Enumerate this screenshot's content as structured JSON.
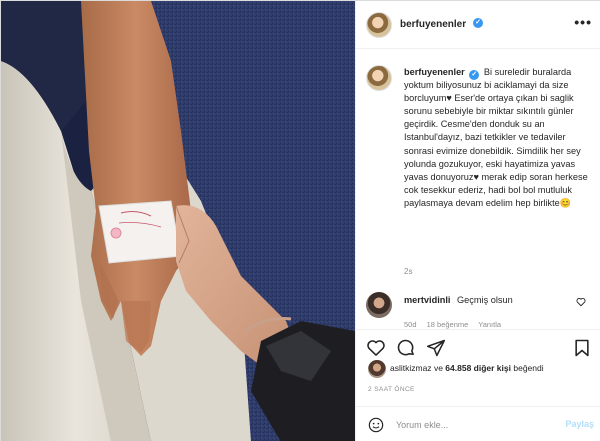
{
  "post": {
    "author": "berfuyenenler",
    "caption_author": "berfuyenenler",
    "caption": "Bi sureledir buralarda yoktum biliyosunuz bi aciklamayi da size borcluyum♥ Eser'de ortaya çıkan bi saglik sorunu sebebiyle bir miktar sıkıntılı günler geçirdik. Cesme'den donduk su an Istanbul'dayız, bazi tetkikler ve tedaviler sonrasi evimize donebildik. Simdilik her sey yolunda gozukuyor, eski hayatimiza yavas yavas donuyoruz♥ merak edip soran herkese cok tesekkur ederiz, hadi bol bol mutluluk paylasmaya devam edelim hep birlikte😊",
    "caption_time": "2s",
    "more_label": "•••"
  },
  "comment": {
    "author": "mertvidinli",
    "text": "Geçmiş olsun",
    "time": "50d",
    "likes": "18 beğenme",
    "reply": "Yanıtla"
  },
  "likes": {
    "first_user": "aslitkizmaz",
    "connector": "ve",
    "others": "64.858 diğer kişi",
    "suffix": "beğendi"
  },
  "posted_ago": "2 SAAT ÖNCE",
  "comment_box": {
    "placeholder": "Yorum ekle...",
    "post_label": "Paylaş"
  },
  "colors": {
    "verified": "#3897f0",
    "muted": "#8e8e8e",
    "post_disabled": "#b2dffc"
  }
}
